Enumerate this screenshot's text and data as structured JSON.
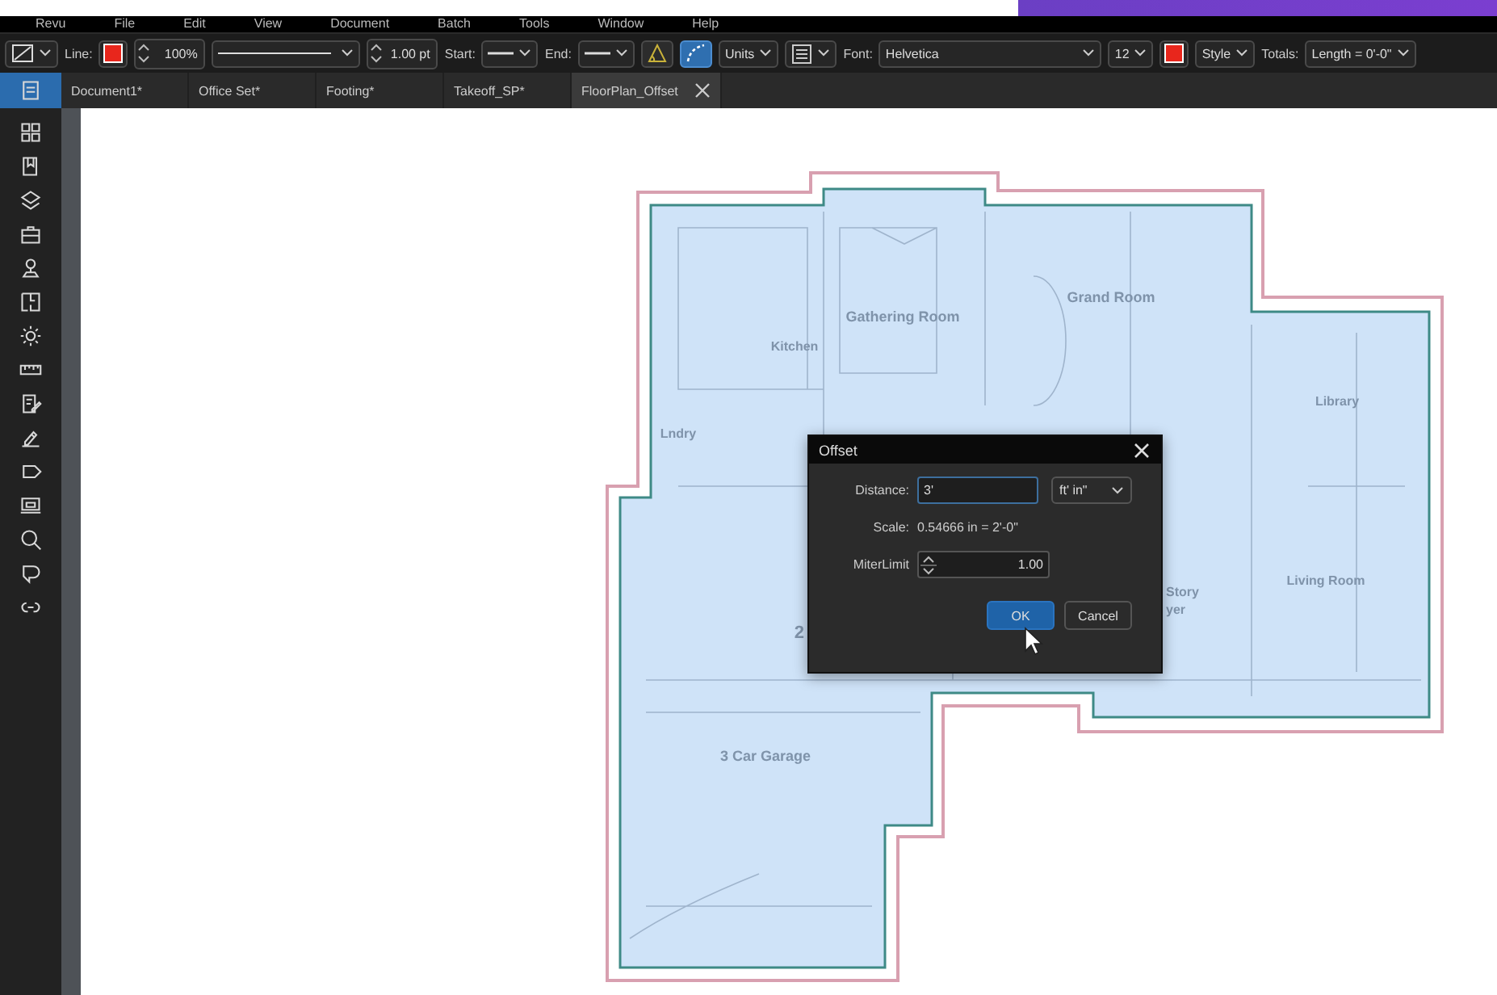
{
  "menu": [
    "Revu",
    "File",
    "Edit",
    "View",
    "Document",
    "Batch",
    "Tools",
    "Window",
    "Help"
  ],
  "toolbar": [
    {
      "kind": "tool_menu"
    },
    {
      "kind": "color",
      "label": "Line:",
      "color": "#e8261c"
    },
    {
      "kind": "spinner",
      "value": "100%"
    },
    {
      "kind": "line_style"
    },
    {
      "kind": "spinner",
      "value": "1.00 pt"
    },
    {
      "kind": "line_end",
      "label": "Start:"
    },
    {
      "kind": "line_end",
      "label": "End:"
    },
    {
      "kind": "angle_tool",
      "on": false
    },
    {
      "kind": "arc_tool",
      "on": true
    },
    {
      "kind": "dropdown",
      "value": "Units"
    },
    {
      "kind": "align_menu"
    },
    {
      "kind": "font_select",
      "label": "Font:",
      "value": "Helvetica"
    },
    {
      "kind": "dropdown",
      "value": "12"
    },
    {
      "kind": "color",
      "color": "#e8261c"
    },
    {
      "kind": "dropdown",
      "value": "Style"
    },
    {
      "kind": "dropdown",
      "label": "Totals:",
      "value": "Length = 0'-0\""
    }
  ],
  "sidebar": {
    "items": [
      {
        "selected": true
      },
      {
        "selected": false
      },
      {
        "selected": false
      },
      {
        "selected": false
      },
      {
        "selected": false
      },
      {
        "selected": false
      },
      {
        "selected": false
      },
      {
        "selected": false
      },
      {
        "selected": false
      },
      {
        "selected": false
      },
      {
        "selected": false
      },
      {
        "selected": false
      },
      {
        "selected": false
      },
      {
        "selected": false
      },
      {
        "selected": false
      },
      {
        "selected": false
      }
    ]
  },
  "tabs": [
    {
      "label": "Document1*",
      "selected": false
    },
    {
      "label": "Office Set*",
      "selected": false
    },
    {
      "label": "Footing*",
      "selected": false
    },
    {
      "label": "Takeoff_SP*",
      "selected": false
    },
    {
      "label": "FloorPlan_Offset",
      "selected": true
    }
  ],
  "floor_plan": {
    "rooms": [
      "Gathering Room",
      "Grand Room",
      "Kitchen",
      "Lndry",
      "Library",
      "Living Room",
      "Story",
      "yer",
      "2",
      "3 Car Garage"
    ]
  },
  "dialog": {
    "title": "Offset",
    "fields": [
      {
        "kind": "text",
        "label": "Distance:",
        "value": "3'",
        "unit": "ft' in\""
      },
      {
        "kind": "readout",
        "label": "Scale:",
        "value": "0.54666 in = 2'-0\""
      },
      {
        "kind": "spinner",
        "label": "MiterLimit",
        "value": "1.00"
      }
    ],
    "buttons": [
      {
        "label": "OK",
        "primary": true
      },
      {
        "label": "Cancel",
        "primary": false
      }
    ]
  }
}
